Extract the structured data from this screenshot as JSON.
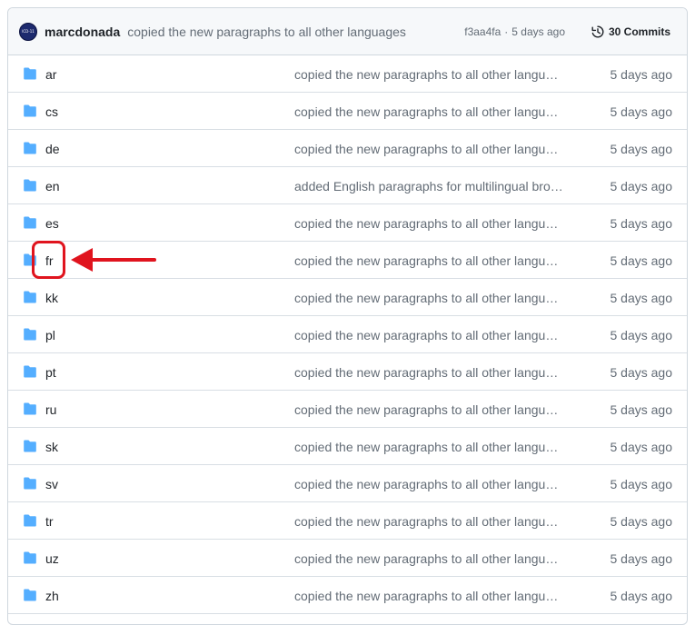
{
  "header": {
    "avatar_text": "ICD-11",
    "author": "marcdonada",
    "commit_message": "copied the new paragraphs to all other languages",
    "commit_hash": "f3aa4fa",
    "separator": "·",
    "commit_time": "5 days ago",
    "commits_label": "30 Commits"
  },
  "rows": [
    {
      "name": "ar",
      "message": "copied the new paragraphs to all other langua…",
      "date": "5 days ago"
    },
    {
      "name": "cs",
      "message": "copied the new paragraphs to all other langua…",
      "date": "5 days ago"
    },
    {
      "name": "de",
      "message": "copied the new paragraphs to all other langua…",
      "date": "5 days ago"
    },
    {
      "name": "en",
      "message": "added English paragraphs for multilingual bro…",
      "date": "5 days ago"
    },
    {
      "name": "es",
      "message": "copied the new paragraphs to all other langua…",
      "date": "5 days ago"
    },
    {
      "name": "fr",
      "message": "copied the new paragraphs to all other langua…",
      "date": "5 days ago"
    },
    {
      "name": "kk",
      "message": "copied the new paragraphs to all other langua…",
      "date": "5 days ago"
    },
    {
      "name": "pl",
      "message": "copied the new paragraphs to all other langua…",
      "date": "5 days ago"
    },
    {
      "name": "pt",
      "message": "copied the new paragraphs to all other langua…",
      "date": "5 days ago"
    },
    {
      "name": "ru",
      "message": "copied the new paragraphs to all other langua…",
      "date": "5 days ago"
    },
    {
      "name": "sk",
      "message": "copied the new paragraphs to all other langua…",
      "date": "5 days ago"
    },
    {
      "name": "sv",
      "message": "copied the new paragraphs to all other langua…",
      "date": "5 days ago"
    },
    {
      "name": "tr",
      "message": "copied the new paragraphs to all other langua…",
      "date": "5 days ago"
    },
    {
      "name": "uz",
      "message": "copied the new paragraphs to all other langua…",
      "date": "5 days ago"
    },
    {
      "name": "zh",
      "message": "copied the new paragraphs to all other langua…",
      "date": "5 days ago"
    }
  ],
  "icons": {
    "folder": "folder-icon",
    "history": "history-icon"
  },
  "colors": {
    "folder": "#54aeff",
    "annotation": "#e0141e",
    "muted_text": "#636c76",
    "header_bg": "#f6f8fa"
  }
}
